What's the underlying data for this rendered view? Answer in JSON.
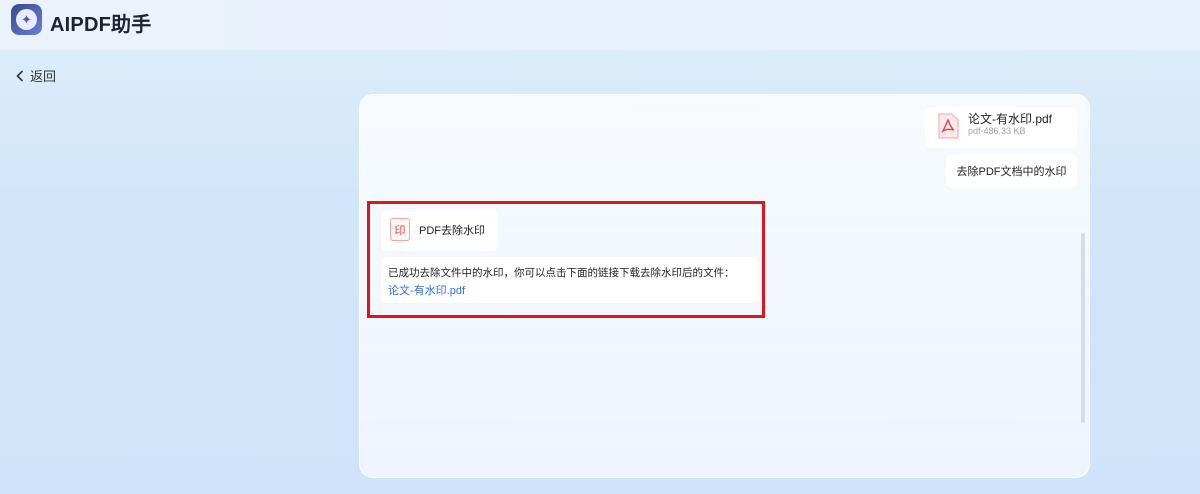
{
  "app": {
    "title": "AIPDF助手",
    "logo_icon": "sparkle-icon"
  },
  "nav": {
    "back_label": "返回"
  },
  "chat": {
    "uploaded_file": {
      "name": "论文-有水印.pdf",
      "size": "pdf-486.33 KB",
      "icon": "pdf-file-icon"
    },
    "user_message": "去除PDF文档中的水印",
    "tool": {
      "label": "PDF去除水印",
      "icon_glyph": "印"
    },
    "reply": {
      "text": "已成功去除文件中的水印，你可以点击下面的链接下载去除水印后的文件：",
      "link": "论文-有水印.pdf"
    }
  },
  "colors": {
    "highlight": "#e0141e",
    "link": "#2f6fe0",
    "pdf_red": "#e2454a"
  }
}
